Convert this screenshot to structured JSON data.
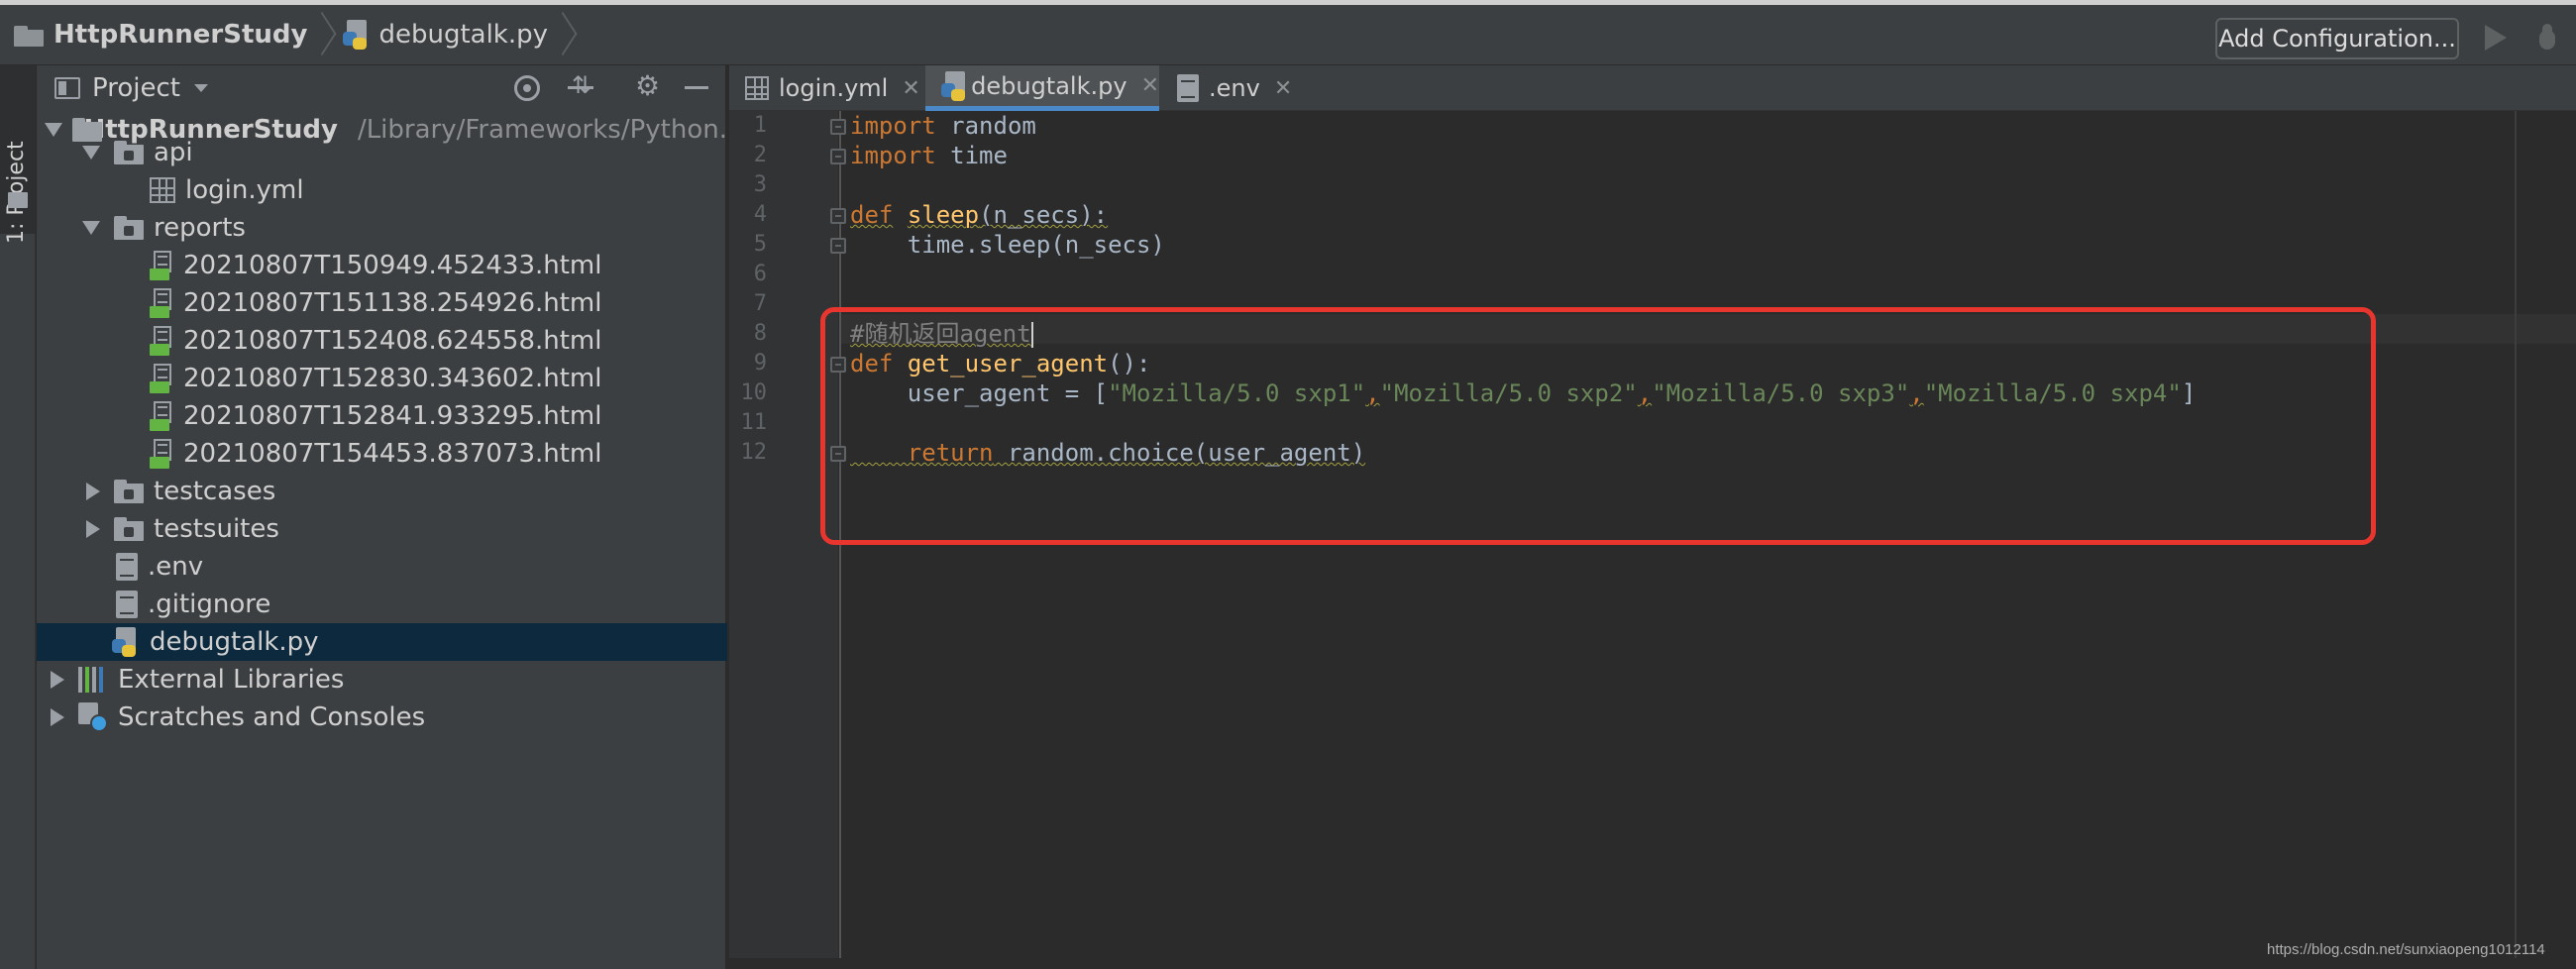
{
  "navbar": {
    "project_crumb": "HttpRunnerStudy",
    "file_crumb": "debugtalk.py",
    "add_config_label": "Add Configuration...",
    "run_icon": "run-icon",
    "debug_icon": "debug-icon"
  },
  "side_strip": {
    "tab_label": "1: Project"
  },
  "project_panel": {
    "title": "Project",
    "tree": {
      "root": {
        "name": "HttpRunnerStudy",
        "path": "/Library/Frameworks/Python."
      },
      "api": {
        "name": "api",
        "children": [
          "login.yml"
        ]
      },
      "reports": {
        "name": "reports",
        "children": [
          "20210807T150949.452433.html",
          "20210807T151138.254926.html",
          "20210807T152408.624558.html",
          "20210807T152830.343602.html",
          "20210807T152841.933295.html",
          "20210807T154453.837073.html"
        ]
      },
      "testcases": "testcases",
      "testsuites": "testsuites",
      "env": ".env",
      "gitignore": ".gitignore",
      "debugtalk": "debugtalk.py",
      "external_libraries": "External Libraries",
      "scratches": "Scratches and Consoles"
    }
  },
  "tabs": [
    {
      "label": "login.yml",
      "active": false
    },
    {
      "label": "debugtalk.py",
      "active": true
    },
    {
      "label": ".env",
      "active": false
    }
  ],
  "editor": {
    "line_numbers": [
      "1",
      "2",
      "3",
      "4",
      "5",
      "6",
      "7",
      "8",
      "9",
      "10",
      "11",
      "12"
    ],
    "lines": {
      "l1_kw": "import",
      "l1_rest": " random",
      "l2_kw": "import",
      "l2_rest": " time",
      "l4_kw": "def",
      "l4_fn": "sleep",
      "l4_rest": "(n_secs):",
      "l5": "    time.sleep(n_secs)",
      "l8_cmt": "#随机返回agent",
      "l9_kw": "def",
      "l9_fn": "get_user_agent",
      "l9_rest": "():",
      "l10_a": "    user_agent = [",
      "l10_s1": "\"Mozilla/5.0 sxp1\"",
      "l10_s2": "\"Mozilla/5.0 sxp2\"",
      "l10_s3": "\"Mozilla/5.0 sxp3\"",
      "l10_s4": "\"Mozilla/5.0 sxp4\"",
      "l10_end": "]",
      "l10_comma": ",",
      "l12_kw": "    return",
      "l12_rest": " random.choice(user_agent)"
    }
  },
  "watermark": "https://blog.csdn.net/sunxiaopeng1012114"
}
